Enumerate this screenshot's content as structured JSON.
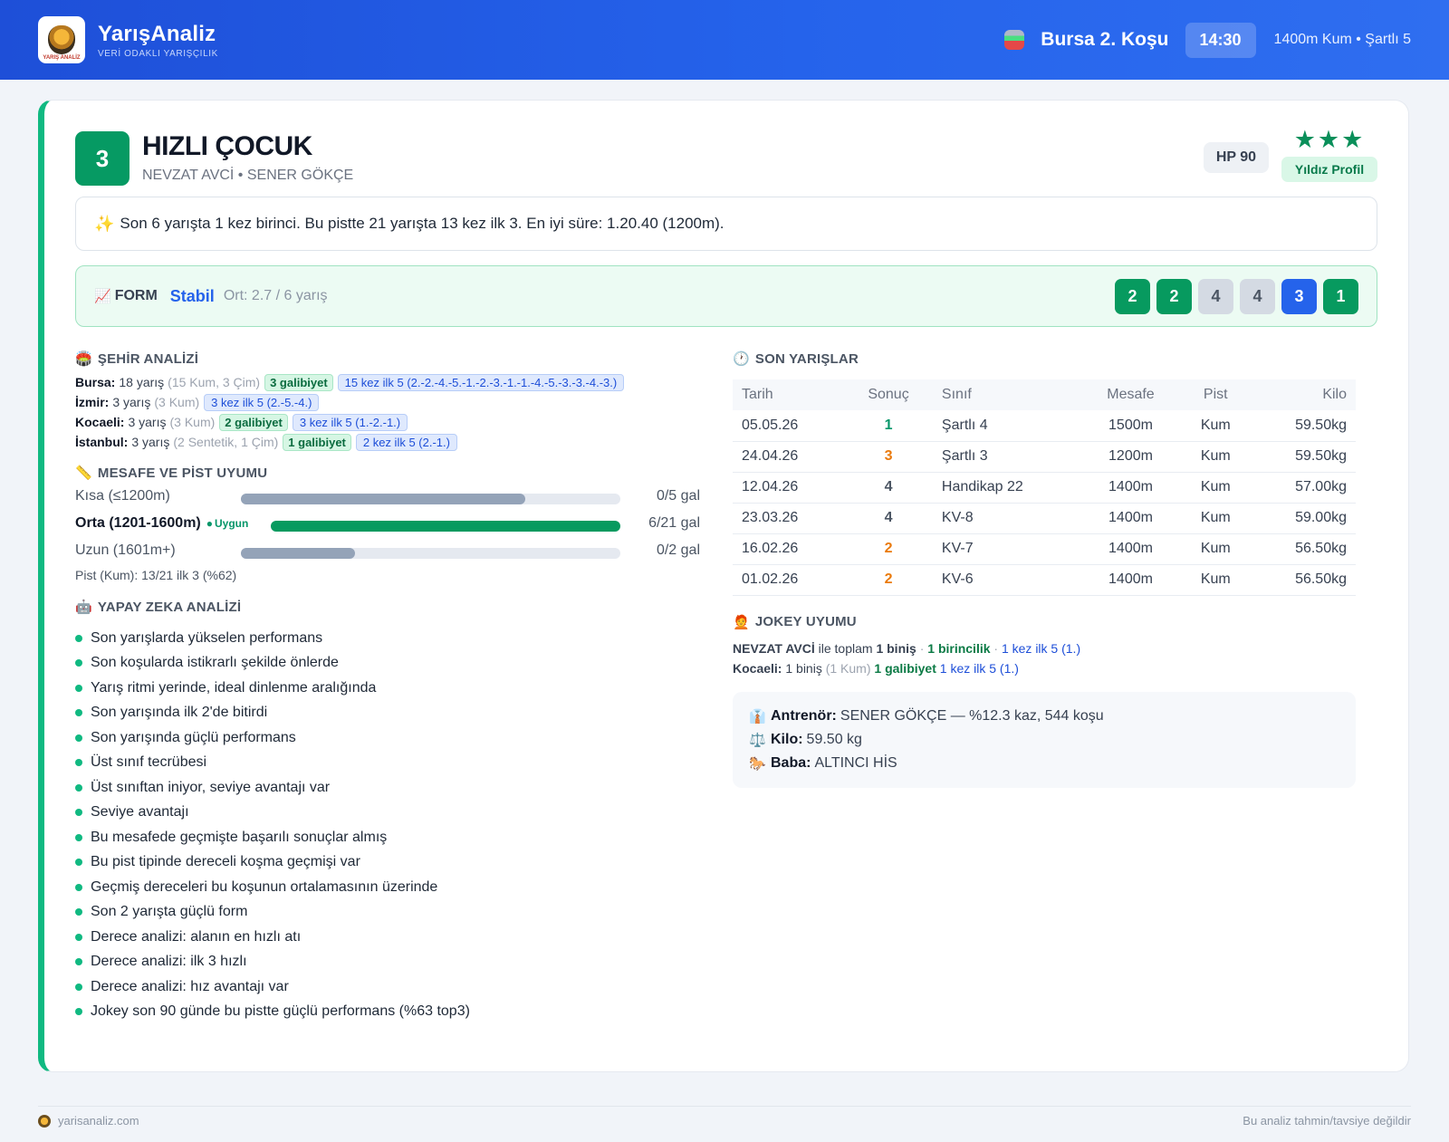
{
  "header": {
    "brand_name": "YarışAnaliz",
    "brand_tag": "VERİ ODAKLI YARIŞÇILIK",
    "logo_text": "YARIŞ ANALİZ",
    "race_title": "Bursa 2. Koşu",
    "time": "14:30",
    "race_meta": "1400m Kum • Şartlı 5"
  },
  "horse": {
    "number": "3",
    "name": "HIZLI ÇOCUK",
    "subtitle": "NEVZAT AVCİ • SENER GÖKÇE",
    "hp": "HP 90",
    "stars": "★★★",
    "profile": "Yıldız Profil"
  },
  "summary": "Son 6 yarışta 1 kez birinci. Bu pistte 21 yarışta 13 kez ilk 3. En iyi süre: 1.20.40 (1200m).",
  "form": {
    "label": "FORM",
    "status": "Stabil",
    "avg": "Ort: 2.7 / 6 yarış",
    "chips": [
      {
        "value": "2",
        "kind": "green"
      },
      {
        "value": "2",
        "kind": "green"
      },
      {
        "value": "4",
        "kind": "gray"
      },
      {
        "value": "4",
        "kind": "gray"
      },
      {
        "value": "3",
        "kind": "blue"
      },
      {
        "value": "1",
        "kind": "green"
      }
    ]
  },
  "city": {
    "title": "ŞEHİR ANALİZİ",
    "rows": [
      {
        "city": "Bursa:",
        "races": "18 yarış",
        "detail": "(15 Kum, 3 Çim)",
        "wins": "3 galibiyet",
        "top5": "15 kez ilk 5 (2.-2.-4.-5.-1.-2.-3.-1.-1.-4.-5.-3.-3.-4.-3.)"
      },
      {
        "city": "İzmir:",
        "races": "3 yarış",
        "detail": "(3 Kum)",
        "wins": "",
        "top5": "3 kez ilk 5 (2.-5.-4.)"
      },
      {
        "city": "Kocaeli:",
        "races": "3 yarış",
        "detail": "(3 Kum)",
        "wins": "2 galibiyet",
        "top5": "3 kez ilk 5 (1.-2.-1.)"
      },
      {
        "city": "İstanbul:",
        "races": "3 yarış",
        "detail": "(2 Sentetik, 1 Çim)",
        "wins": "1 galibiyet",
        "top5": "2 kez ilk 5 (2.-1.)"
      }
    ]
  },
  "distance": {
    "title": "MESAFE VE PİST UYUMU",
    "rows": [
      {
        "label": "Kısa (≤1200m)",
        "badge": "",
        "fill": 0.75,
        "color": "#94a3b8",
        "gal": "0/5 gal",
        "bold": false
      },
      {
        "label": "Orta (1201-1600m)",
        "badge": "Uygun",
        "fill": 1.0,
        "color": "#079a5f",
        "gal": "6/21 gal",
        "bold": true
      },
      {
        "label": "Uzun (1601m+)",
        "badge": "",
        "fill": 0.3,
        "color": "#94a3b8",
        "gal": "0/2 gal",
        "bold": false
      }
    ],
    "pist": "Pist (Kum): 13/21 ilk 3 (%62)"
  },
  "ai": {
    "title": "YAPAY ZEKA ANALİZİ",
    "items": [
      "Son yarışlarda yükselen performans",
      "Son koşularda istikrarlı şekilde önlerde",
      "Yarış ritmi yerinde, ideal dinlenme aralığında",
      "Son yarışında ilk 2'de bitirdi",
      "Son yarışında güçlü performans",
      "Üst sınıf tecrübesi",
      "Üst sınıftan iniyor, seviye avantajı var",
      "Seviye avantajı",
      "Bu mesafede geçmişte başarılı sonuçlar almış",
      "Bu pist tipinde dereceli koşma geçmişi var",
      "Geçmiş dereceleri bu koşunun ortalamasının üzerinde",
      "Son 2 yarışta güçlü form",
      "Derece analizi: alanın en hızlı atı",
      "Derece analizi: ilk 3 hızlı",
      "Derece analizi: hız avantajı var",
      "Jokey son 90 günde bu pistte güçlü performans (%63 top3)"
    ]
  },
  "races": {
    "title": "SON YARIŞLAR",
    "headers": [
      "Tarih",
      "Sonuç",
      "Sınıf",
      "Mesafe",
      "Pist",
      "Kilo"
    ],
    "rows": [
      {
        "date": "05.05.26",
        "result": "1",
        "kind": "win",
        "class": "Şartlı 4",
        "dist": "1500m",
        "pist": "Kum",
        "kilo": "59.50kg"
      },
      {
        "date": "24.04.26",
        "result": "3",
        "kind": "place",
        "class": "Şartlı 3",
        "dist": "1200m",
        "pist": "Kum",
        "kilo": "59.50kg"
      },
      {
        "date": "12.04.26",
        "result": "4",
        "kind": "other",
        "class": "Handikap 22",
        "dist": "1400m",
        "pist": "Kum",
        "kilo": "57.00kg"
      },
      {
        "date": "23.03.26",
        "result": "4",
        "kind": "other",
        "class": "KV-8",
        "dist": "1400m",
        "pist": "Kum",
        "kilo": "59.00kg"
      },
      {
        "date": "16.02.26",
        "result": "2",
        "kind": "place",
        "class": "KV-7",
        "dist": "1400m",
        "pist": "Kum",
        "kilo": "56.50kg"
      },
      {
        "date": "01.02.26",
        "result": "2",
        "kind": "place",
        "class": "KV-6",
        "dist": "1400m",
        "pist": "Kum",
        "kilo": "56.50kg"
      }
    ]
  },
  "jokey": {
    "title": "JOKEY UYUMU",
    "line1": {
      "name": "NEVZAT AVCİ",
      "text": "ile toplam",
      "rides": "1 biniş",
      "sep1": "·",
      "wins": "1 birincilik",
      "sep2": "·",
      "top5": "1 kez ilk 5 (1.)"
    },
    "line2": {
      "city": "Kocaeli:",
      "rides": "1 biniş",
      "detail": "(1 Kum)",
      "wins": "1 galibiyet",
      "top5": "1 kez ilk 5 (1.)"
    }
  },
  "info": {
    "trainer_label": "Antrenör:",
    "trainer_value": "SENER GÖKÇE — %12.3 kaz, 544 koşu",
    "kilo_label": "Kilo:",
    "kilo_value": "59.50 kg",
    "sire_label": "Baba:",
    "sire_value": "ALTINCI HİS"
  },
  "footer": {
    "site": "yarisanaliz.com",
    "disclaimer": "Bu analiz tahmin/tavsiye değildir"
  }
}
